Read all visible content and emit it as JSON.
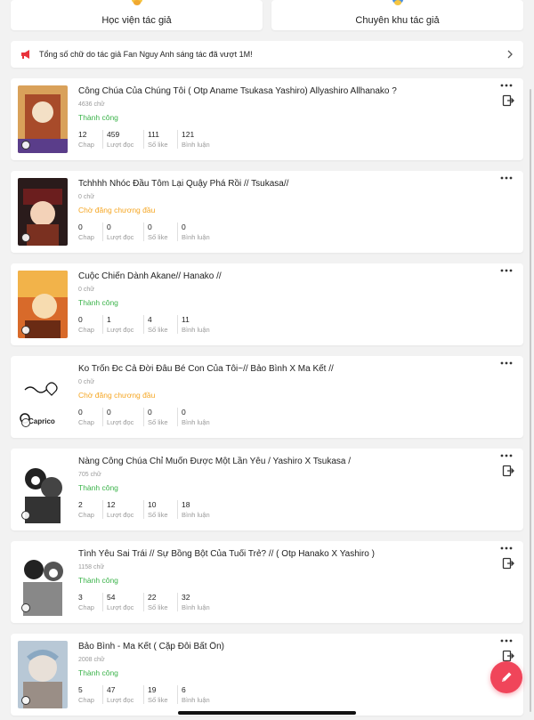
{
  "top_links": [
    {
      "label": "Học viện tác giả",
      "icon": "graduation-icon"
    },
    {
      "label": "Chuyên khu tác giả",
      "icon": "globe-icon"
    }
  ],
  "announcement": {
    "text": "Tổng số chữ do tác giả Fan Nguy Anh sáng tác đã vượt 1M!",
    "icon": "megaphone-icon"
  },
  "stat_labels": {
    "chap": "Chap",
    "reads": "Lượt đọc",
    "likes": "Số like",
    "comments": "Bình luận"
  },
  "stories": [
    {
      "title": "Công Chúa Của Chúng Tôi ( Otp Aname Tsukasa Yashiro) Allyashiro Allhanako ?",
      "words": "4636 chữ",
      "status": "Thành công",
      "status_type": "ok",
      "chap": "12",
      "reads": "459",
      "likes": "111",
      "comments": "121"
    },
    {
      "title": "Tchhhh Nhóc Đầu Tôm Lại Quậy Phá Rồi // Tsukasa//",
      "words": "0 chữ",
      "status": "Chờ đăng chương đầu",
      "status_type": "wait",
      "chap": "0",
      "reads": "0",
      "likes": "0",
      "comments": "0"
    },
    {
      "title": "Cuộc Chiến Dành Akane// Hanako //",
      "words": "0 chữ",
      "status": "Thành công",
      "status_type": "ok",
      "chap": "0",
      "reads": "1",
      "likes": "4",
      "comments": "11"
    },
    {
      "title": "Ko Trốn Đc Cả Đời Đâu Bé Con Của Tôi~// Bảo Bình X Ma Kết //",
      "words": "0 chữ",
      "status": "Chờ đăng chương đầu",
      "status_type": "wait",
      "chap": "0",
      "reads": "0",
      "likes": "0",
      "comments": "0",
      "thumb_text": "Caprico"
    },
    {
      "title": "Nàng Công Chúa Chỉ Muốn Được Một Lần Yêu / Yashiro X Tsukasa /",
      "words": "705 chữ",
      "status": "Thành công",
      "status_type": "ok",
      "chap": "2",
      "reads": "12",
      "likes": "10",
      "comments": "18"
    },
    {
      "title": "Tình Yêu Sai Trái // Sự Bồng Bột Của Tuổi Trẻ? // ( Otp Hanako X Yashiro )",
      "words": "1158 chữ",
      "status": "Thành công",
      "status_type": "ok",
      "chap": "3",
      "reads": "54",
      "likes": "22",
      "comments": "32"
    },
    {
      "title": "Bảo Bình - Ma Kết ( Cặp Đôi Bất Ổn)",
      "words": "2008 chữ",
      "status": "Thành công",
      "status_type": "ok",
      "chap": "5",
      "reads": "47",
      "likes": "19",
      "comments": "6"
    }
  ],
  "colors": {
    "success": "#3bb34a",
    "waiting": "#f5a623",
    "fab": "#f0455a"
  },
  "fab": {
    "icon": "pencil-icon"
  }
}
